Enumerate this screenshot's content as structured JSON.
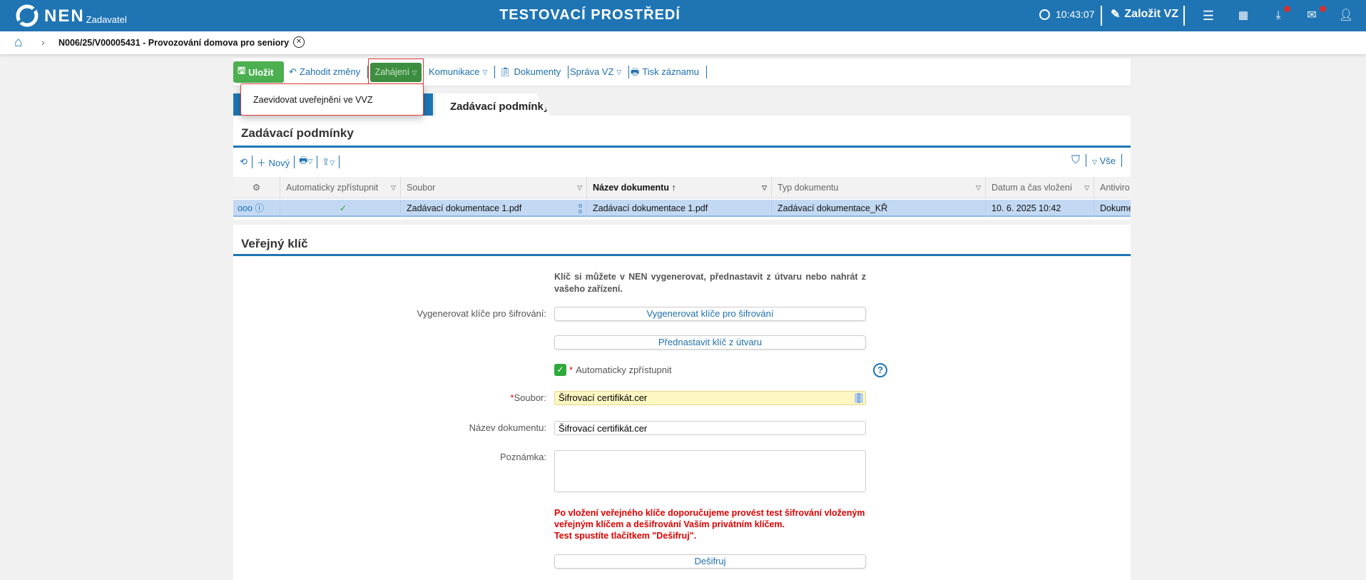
{
  "header": {
    "logo": "NEN",
    "logo_sub": "Zadavatel",
    "env_title": "TESTOVACÍ PROSTŘEDÍ",
    "clock": "10:43:07",
    "create_label": "Založit VZ"
  },
  "breadcrumb": {
    "title": "N006/25/V00005431 - Provozování domova pro seniory"
  },
  "toolbar": {
    "save": "Uložit",
    "discard": "Zahodit změny",
    "start": "Zahájení",
    "communication": "Komunikace",
    "documents": "Dokumenty",
    "management": "Správa VZ",
    "print": "Tisk záznamu"
  },
  "dropdown": {
    "items": [
      "Zaevidovat uveřejnění ve VVZ"
    ]
  },
  "tabs": {
    "active": "Zadávací podmínky"
  },
  "grid_section": {
    "title": "Zadávací podmínky",
    "new_label": "Nový",
    "filter_all": "Vše",
    "columns": [
      "Automaticky zpřístupnit",
      "Soubor",
      "Název dokumentu",
      "Typ dokumentu",
      "Datum a čas vložení",
      "Antiviro"
    ],
    "rows": [
      {
        "auto": "✓",
        "file": "Zadávací dokumentace 1.pdf",
        "name": "Zadávací dokumentace 1.pdf",
        "type": "Zadávací dokumentace_KŘ",
        "date": "10. 6. 2025 10:42",
        "antivirus": "Dokume"
      }
    ]
  },
  "key_section": {
    "title": "Veřejný klíč",
    "info": "Klíč si můžete v NEN vygenerovat, přednastavit z útvaru nebo nahrát z vašeho zařízení.",
    "generate_label": "Vygenerovat klíče pro šifrování:",
    "generate_button": "Vygenerovat klíče pro šifrování",
    "preset_button": "Přednastavit klíč z útvaru",
    "auto_label": "Automaticky zpřístupnit",
    "auto_checked": true,
    "file_label": "Soubor:",
    "file_value": "Šifrovací certifikát.cer",
    "docname_label": "Název dokumentu:",
    "docname_value": "Šifrovací certifikát.cer",
    "note_label": "Poznámka:",
    "note_value": "",
    "warning_lines": [
      "Po vložení veřejného klíče doporučujeme provést test šifrování vloženým",
      "veřejným klíčem a dešifrování Vaším privátním klíčem.",
      "Test spustíte tlačítkem \"Dešifruj\"."
    ],
    "decrypt_button": "Dešifruj"
  },
  "colors": {
    "header": "#1f75b4",
    "save": "#4caf50",
    "start": "#3e8e41",
    "warning": "#e00000",
    "file_bg": "#fff7c2",
    "row_selected": "#c3d9f3"
  }
}
